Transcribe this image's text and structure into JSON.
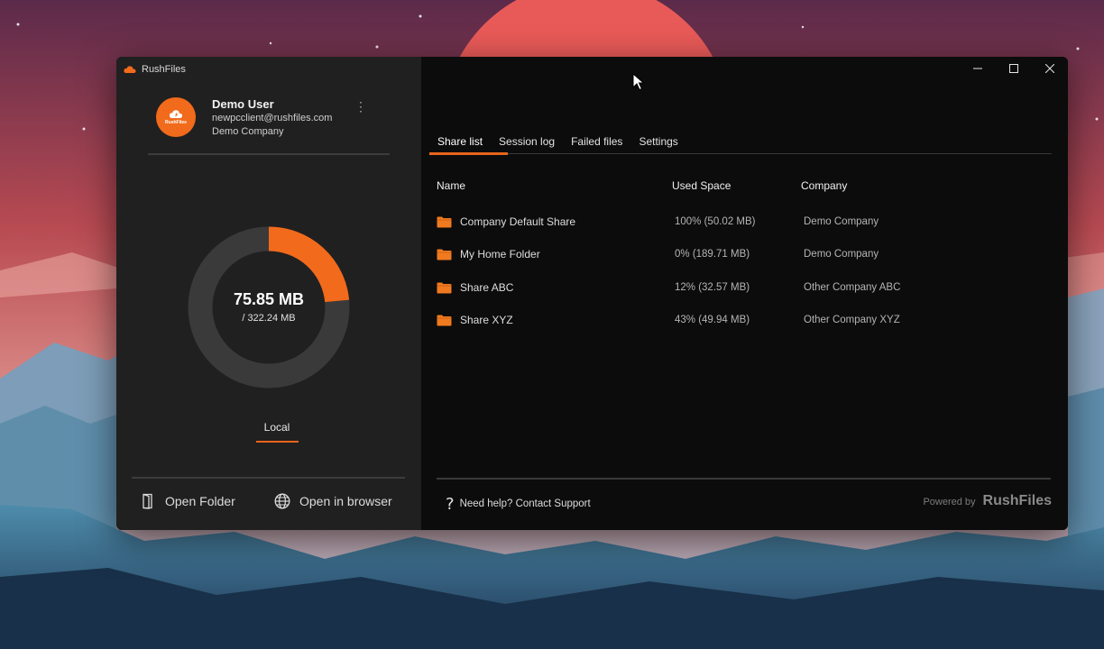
{
  "app": {
    "title": "RushFiles"
  },
  "user": {
    "avatar_text": "RushFiles",
    "name": "Demo User",
    "email": "newpcclient@rushfiles.com",
    "company": "Demo Company",
    "more_icon": "⋮"
  },
  "storage": {
    "used": "75.85 MB",
    "total": "/ 322.24 MB",
    "used_fraction": 0.235,
    "used_color": "#f26a1b",
    "track_color": "#3a3a3a"
  },
  "location_tab": {
    "label": "Local"
  },
  "actions": {
    "open_folder": "Open Folder",
    "open_browser": "Open in browser"
  },
  "tabs": [
    {
      "label": "Share list",
      "active": true
    },
    {
      "label": "Session log",
      "active": false
    },
    {
      "label": "Failed files",
      "active": false
    },
    {
      "label": "Settings",
      "active": false
    }
  ],
  "table": {
    "columns": [
      "Name",
      "Used Space",
      "Company"
    ],
    "rows": [
      {
        "name": "Company Default Share",
        "used_space": "100% (50.02 MB)",
        "company": "Demo Company"
      },
      {
        "name": "My Home Folder",
        "used_space": "0% (189.71 MB)",
        "company": "Demo Company"
      },
      {
        "name": "Share ABC",
        "used_space": "12% (32.57 MB)",
        "company": "Other Company ABC"
      },
      {
        "name": "Share XYZ",
        "used_space": "43% (49.94 MB)",
        "company": "Other Company XYZ"
      }
    ]
  },
  "footer": {
    "help": "Need help? Contact Support",
    "powered_by": "Powered by",
    "brand": "RushFiles"
  },
  "colors": {
    "accent": "#e8651c",
    "folder": "#f07a1f"
  }
}
